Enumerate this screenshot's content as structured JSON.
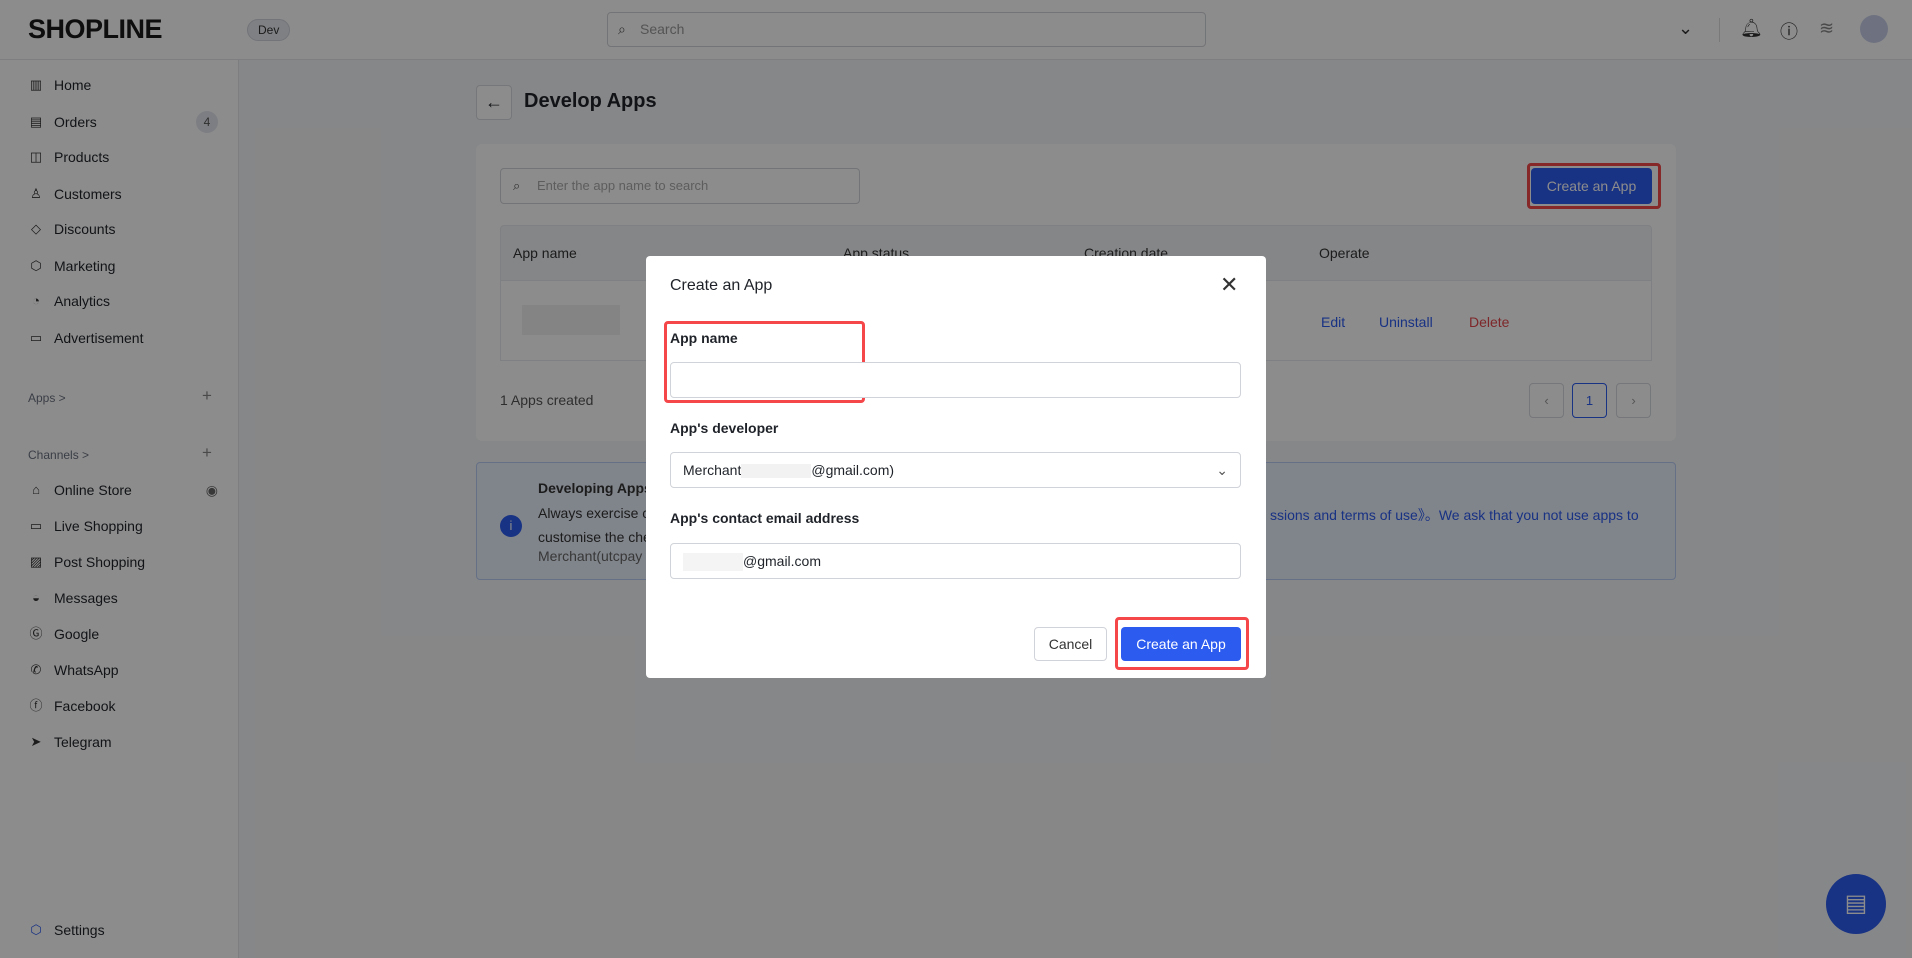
{
  "header": {
    "logo": "SHOPLINE",
    "env_badge": "Dev",
    "search_placeholder": "Search"
  },
  "sidebar": {
    "items": [
      {
        "label": "Home",
        "icon": "home-icon"
      },
      {
        "label": "Orders",
        "icon": "orders-icon",
        "badge": "4"
      },
      {
        "label": "Products",
        "icon": "bag-icon"
      },
      {
        "label": "Customers",
        "icon": "user-icon"
      },
      {
        "label": "Discounts",
        "icon": "tag-icon"
      },
      {
        "label": "Marketing",
        "icon": "cube-icon"
      },
      {
        "label": "Analytics",
        "icon": "chart-icon"
      },
      {
        "label": "Advertisement",
        "icon": "ad-icon"
      }
    ],
    "apps_section": "Apps >",
    "channels_section": "Channels >",
    "channels": [
      {
        "label": "Online Store"
      },
      {
        "label": "Live Shopping"
      },
      {
        "label": "Post Shopping"
      },
      {
        "label": "Messages"
      },
      {
        "label": "Google"
      },
      {
        "label": "WhatsApp"
      },
      {
        "label": "Facebook"
      },
      {
        "label": "Telegram"
      }
    ],
    "settings": "Settings"
  },
  "page": {
    "title": "Develop Apps",
    "search_placeholder": "Enter the app name to search",
    "create_button": "Create an App",
    "columns": [
      "App name",
      "App status",
      "Creation date",
      "Operate"
    ],
    "row_actions": {
      "edit": "Edit",
      "uninstall": "Uninstall",
      "delete": "Delete"
    },
    "count_text": "1 Apps created",
    "current_page": "1",
    "info": {
      "title": "Developing Apps",
      "line1_start": "Always exercise ca",
      "line1_end": "ssions and terms of use》。We ask that you not use apps to",
      "line2": "customise the che",
      "line3": "Merchant(utcpay"
    }
  },
  "dialog": {
    "title": "Create an App",
    "app_name_label": "App name",
    "app_name_value": "",
    "developer_label": "App's developer",
    "developer_value_prefix": "Merchant",
    "developer_value_suffix": "@gmail.com)",
    "email_label": "App's contact email address",
    "email_value_suffix": "@gmail.com",
    "cancel": "Cancel",
    "create": "Create an App"
  },
  "colors": {
    "primary": "#2c5bf0",
    "highlight": "#f5474a",
    "delete": "#e5484d"
  }
}
